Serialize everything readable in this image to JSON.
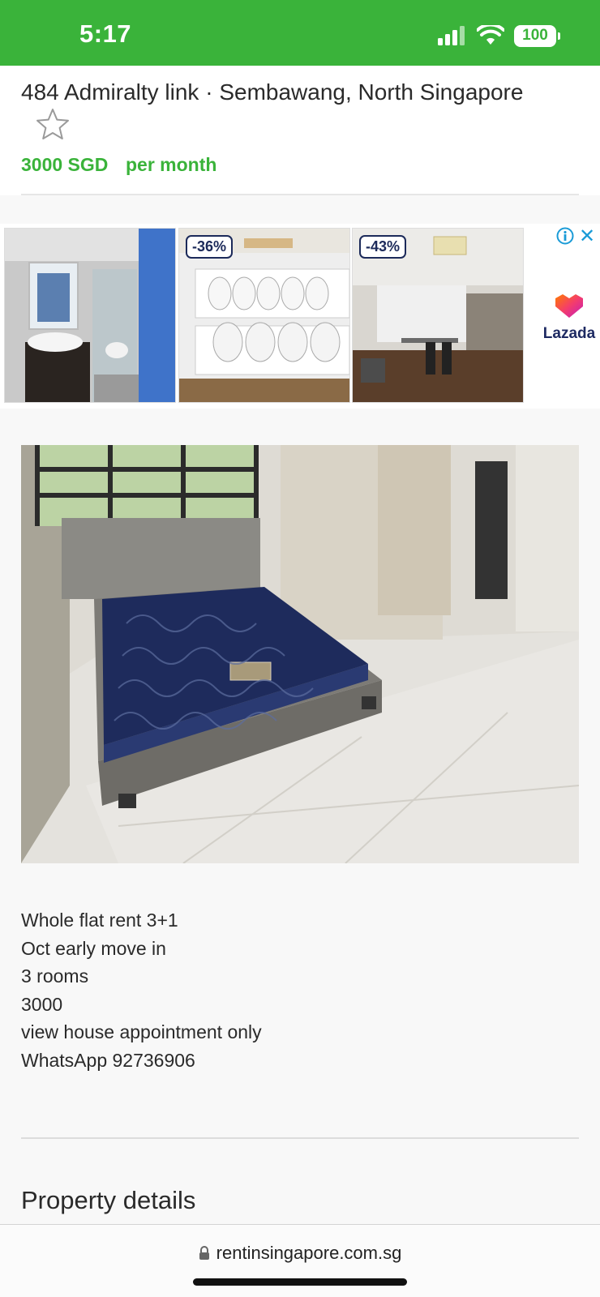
{
  "status_bar": {
    "time": "5:17",
    "battery": "100",
    "icons": [
      "signal-icon",
      "wifi-icon",
      "battery-icon"
    ]
  },
  "listing": {
    "title": "484 Admiralty link · Sembawang, North Singapore",
    "price": "3000 SGD",
    "price_period": "per month"
  },
  "ad": {
    "tiles": [
      {
        "discount": ""
      },
      {
        "discount": "-36%"
      },
      {
        "discount": "-43%"
      }
    ],
    "brand": "Lazada"
  },
  "description": {
    "lines": [
      "Whole flat rent 3+1",
      "Oct early move in",
      "3 rooms",
      "3000",
      "view house appointment only",
      "WhatsApp 92736906"
    ]
  },
  "sections": {
    "property_details": "Property details"
  },
  "browser": {
    "url": "rentinsingapore.com.sg"
  },
  "colors": {
    "accent": "#3ab33a",
    "ad_blue": "#1a9bd7",
    "lazada_navy": "#1e2a62"
  }
}
